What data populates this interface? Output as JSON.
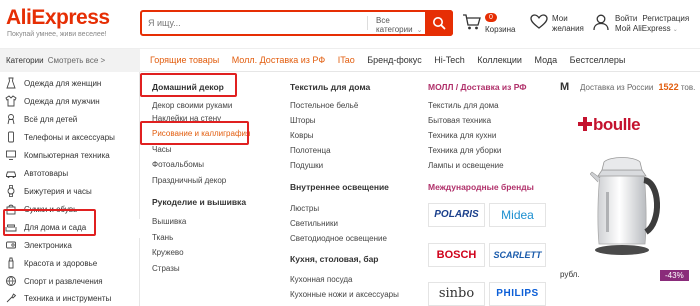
{
  "header": {
    "logo": "AliExpress",
    "slogan": "Покупай умнее, живи веселее!",
    "search": {
      "placeholder": "Я ищу...",
      "category": "Все категории"
    },
    "cart": {
      "count": "0",
      "label": "Корзина"
    },
    "wishlist": {
      "label": "Мои желания"
    },
    "account": {
      "login": "Войти",
      "register": "Регистрация",
      "name": "Мой AliExpress"
    }
  },
  "navbar": {
    "categories_label": "Категории",
    "see_all": "Смотреть все >",
    "links": [
      {
        "label": "Горящие товары",
        "highlight": true
      },
      {
        "label": "Молл. Доставка из РФ",
        "highlight": true
      },
      {
        "label": "ITao",
        "highlight": true
      },
      {
        "label": "Бренд-фокус",
        "highlight": false
      },
      {
        "label": "Hi-Tech",
        "highlight": false
      },
      {
        "label": "Коллекции",
        "highlight": false
      },
      {
        "label": "Мода",
        "highlight": false
      },
      {
        "label": "Бестселлеры",
        "highlight": false
      }
    ]
  },
  "sidebar": {
    "items": [
      {
        "label": "Одежда для женщин",
        "icon": "dress-icon"
      },
      {
        "label": "Одежда для мужчин",
        "icon": "shirt-icon"
      },
      {
        "label": "Всё для детей",
        "icon": "baby-icon"
      },
      {
        "label": "Телефоны и аксессуары",
        "icon": "phone-icon"
      },
      {
        "label": "Компьютерная техника",
        "icon": "computer-icon"
      },
      {
        "label": "Автотовары",
        "icon": "car-icon"
      },
      {
        "label": "Бижутерия и часы",
        "icon": "watch-icon"
      },
      {
        "label": "Сумки и обувь",
        "icon": "bag-icon"
      },
      {
        "label": "Для дома и сада",
        "icon": "sofa-icon"
      },
      {
        "label": "Электроника",
        "icon": "electronics-icon"
      },
      {
        "label": "Красота и здоровье",
        "icon": "beauty-icon"
      },
      {
        "label": "Спорт и развлечения",
        "icon": "sport-icon"
      },
      {
        "label": "Техника и инструменты",
        "icon": "tools-icon"
      }
    ]
  },
  "mega": {
    "col1": {
      "head": "Домашний декор",
      "items": [
        "Декор своими руками",
        "Наклейки на стену",
        "Рисование и каллиграфия",
        "Часы",
        "Фотоальбомы",
        "Праздничный декор"
      ],
      "head2": "Рукоделие и вышивка",
      "items2": [
        "Вышивка",
        "Ткань",
        "Кружево",
        "Стразы"
      ]
    },
    "col2": {
      "head": "Текстиль для дома",
      "items": [
        "Постельное бельё",
        "Шторы",
        "Ковры",
        "Полотенца",
        "Подушки"
      ],
      "head2": "Внутреннее освещение",
      "items2": [
        "Люстры",
        "Светильники",
        "Светодиодное освещение"
      ],
      "head3": "Кухня, столовая, бар",
      "items3": [
        "Кухонная посуда",
        "Кухонные ножи и аксессуары"
      ]
    },
    "col3": {
      "head": "МОЛЛ / Доставка из РФ",
      "items": [
        "Текстиль для дома",
        "Бытовая техника",
        "Техника для кухни",
        "Техника для уборки",
        "Лампы и освещение"
      ],
      "head2": "Международные бренды",
      "brands": [
        "POLARIS",
        "Midea",
        "BOSCH",
        "SCARLETT",
        "sinbo",
        "PHILIPS"
      ]
    }
  },
  "promo": {
    "letter": "М",
    "text": "Доставка из России",
    "count": "1522",
    "unit": "тов.",
    "brand": "boulle",
    "fragment": "рубл.",
    "discount": "-43%"
  },
  "colors": {
    "accent": "#e62e04",
    "nav_highlight": "#e25d0e",
    "annotation": "#e02020"
  }
}
